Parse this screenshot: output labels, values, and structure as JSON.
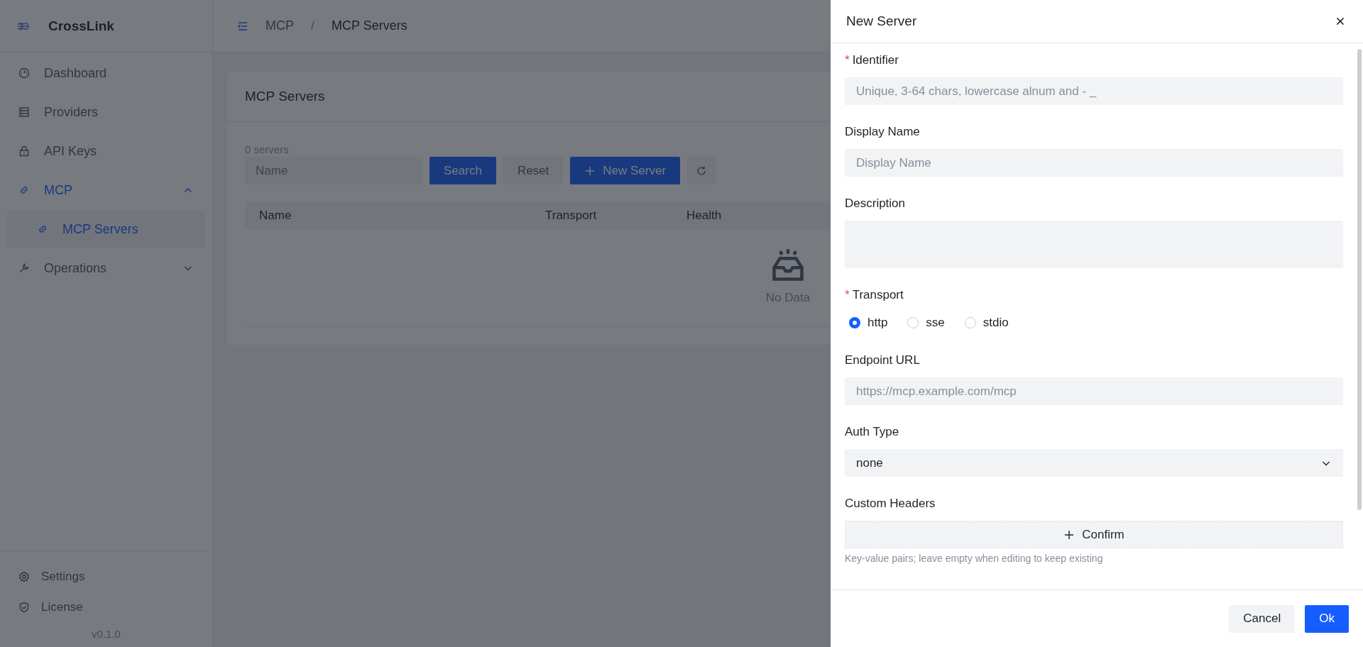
{
  "app": {
    "name": "CrossLink",
    "version": "v0.1.0"
  },
  "sidebar": {
    "items": [
      {
        "label": "Dashboard",
        "selected": false
      },
      {
        "label": "Providers",
        "selected": false
      },
      {
        "label": "API Keys",
        "selected": false
      },
      {
        "label": "MCP",
        "expanded": true,
        "children": [
          {
            "label": "MCP Servers",
            "selected": true
          }
        ]
      },
      {
        "label": "Operations",
        "expanded": false
      }
    ],
    "footer_items": [
      {
        "label": "Settings"
      },
      {
        "label": "License"
      }
    ]
  },
  "breadcrumb": {
    "items": [
      "MCP",
      "MCP Servers"
    ],
    "separator": "/"
  },
  "page": {
    "title": "MCP Servers",
    "count": "0 servers",
    "search": {
      "placeholder": "Name"
    },
    "buttons": [
      {
        "label": "Search",
        "kind": "primary"
      },
      {
        "label": "Reset",
        "kind": "secondary"
      },
      {
        "label": "New Server",
        "kind": "add"
      }
    ],
    "table": {
      "columns": [
        "Name",
        "Transport",
        "Health"
      ],
      "empty_text": "No Data"
    }
  },
  "drawer": {
    "title": "New Server",
    "required_mark": "*",
    "fields": [
      {
        "kind": "input",
        "label": "Identifier",
        "required": true,
        "placeholder": "Unique, 3-64 chars, lowercase alnum and - _"
      },
      {
        "kind": "input",
        "label": "Display Name",
        "required": false,
        "placeholder": "Display Name"
      },
      {
        "kind": "textarea",
        "label": "Description",
        "required": false
      },
      {
        "kind": "radio",
        "label": "Transport",
        "required": true,
        "options": [
          {
            "label": "http",
            "selected": true
          },
          {
            "label": "sse",
            "selected": false
          },
          {
            "label": "stdio",
            "selected": false
          }
        ]
      },
      {
        "kind": "input",
        "label": "Endpoint URL",
        "required": false,
        "placeholder": "https://mcp.example.com/mcp"
      },
      {
        "kind": "select",
        "label": "Auth Type",
        "required": false,
        "value": "none"
      },
      {
        "kind": "add",
        "label": "Custom Headers",
        "required": false,
        "button": "Confirm",
        "help": "Key-value pairs; leave empty when editing to keep existing"
      }
    ],
    "buttons": [
      {
        "label": "Cancel",
        "kind": "secondary"
      },
      {
        "label": "Ok",
        "kind": "primary"
      }
    ]
  }
}
